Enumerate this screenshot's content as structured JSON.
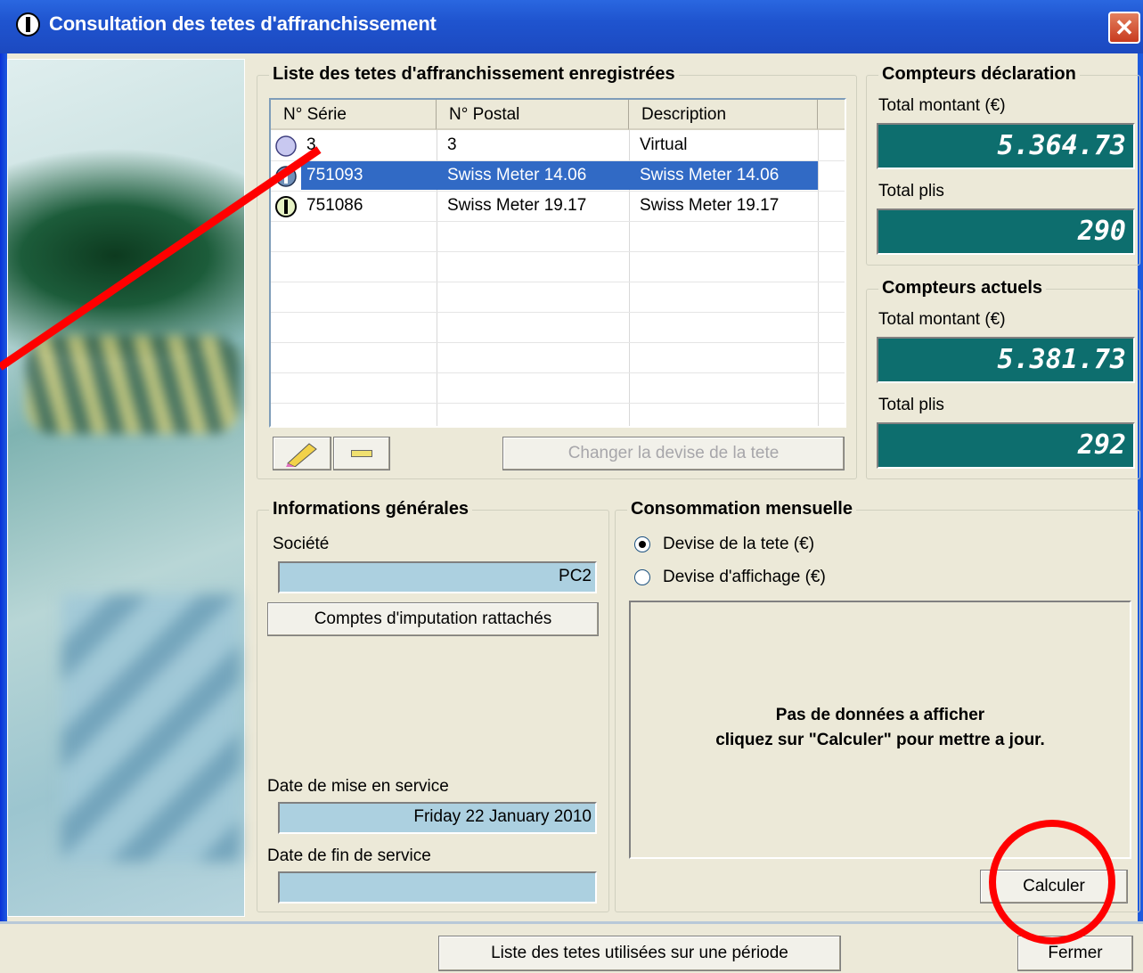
{
  "window": {
    "title": "Consultation des tetes d'affranchissement",
    "close_symbol": "✕"
  },
  "list_group": {
    "legend": "Liste des tetes d'affranchissement enregistrées",
    "columns": [
      "N° Série",
      "N° Postal",
      "Description"
    ],
    "rows": [
      {
        "serie": "3",
        "postal": "3",
        "description": "Virtual",
        "icon": "virtual-head-icon",
        "selected": false
      },
      {
        "serie": "751093",
        "postal": "Swiss Meter 14.06",
        "description": "Swiss Meter 14.06",
        "icon": "meter-head-icon",
        "selected": true
      },
      {
        "serie": "751086",
        "postal": "Swiss Meter 19.17",
        "description": "Swiss Meter 19.17",
        "icon": "power-head-icon",
        "selected": false
      }
    ],
    "change_currency_button": "Changer la devise de la tete"
  },
  "declaration_counters": {
    "legend": "Compteurs déclaration",
    "amount_label": "Total montant (€)",
    "amount_value": "5.364.73",
    "items_label": "Total plis",
    "items_value": "290"
  },
  "current_counters": {
    "legend": "Compteurs actuels",
    "amount_label": "Total montant (€)",
    "amount_value": "5.381.73",
    "items_label": "Total plis",
    "items_value": "292"
  },
  "general_info": {
    "legend": "Informations générales",
    "company_label": "Société",
    "company_value": "PC2",
    "accounts_button": "Comptes d'imputation rattachés",
    "start_date_label": "Date de mise en service",
    "start_date_value": "Friday 22 January 2010",
    "end_date_label": "Date de fin de service",
    "end_date_value": ""
  },
  "monthly": {
    "legend": "Consommation mensuelle",
    "radio_head_currency": "Devise de la tete (€)",
    "radio_display_currency": "Devise d'affichage (€)",
    "empty_line1": "Pas de données a afficher",
    "empty_line2": "cliquez sur \"Calculer\" pour mettre a jour.",
    "calculate_button": "Calculer"
  },
  "footer": {
    "period_button": "Liste des tetes utilisées sur une période",
    "close_button": "Fermer"
  },
  "colors": {
    "counter_bg": "#0d6e6e",
    "field_bg": "#acd0e0",
    "selection": "#316ac5",
    "annotation": "#ff0000"
  }
}
